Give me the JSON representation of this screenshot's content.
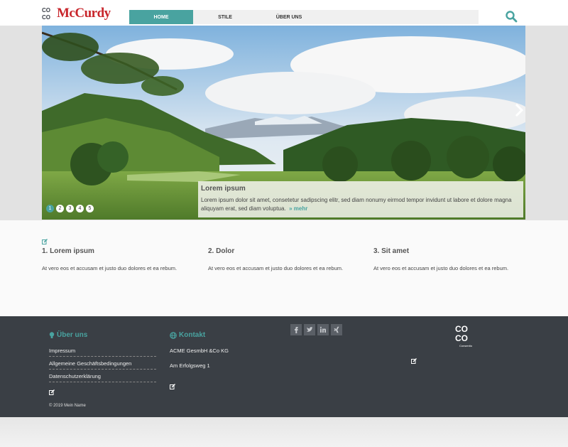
{
  "header": {
    "logo": {
      "letters": [
        "CO",
        "CO"
      ],
      "brand": "McCurdy"
    },
    "nav": [
      {
        "label": "HOME",
        "active": true
      },
      {
        "label": "STILE",
        "active": false
      },
      {
        "label": "ÜBER UNS",
        "active": false
      }
    ]
  },
  "slider": {
    "dots": [
      "1",
      "2",
      "3",
      "4",
      "5"
    ],
    "active_index": 0,
    "caption": {
      "title": "Lorem ipsum",
      "text": "Lorem ipsum dolor sit amet, consetetur sadipscing elitr, sed diam nonumy eirmod tempor invidunt ut labore et dolore magna aliquyam erat, sed diam voluptua.",
      "more": "mehr"
    }
  },
  "teasers": [
    {
      "title": "1. Lorem ipsum",
      "text": "At vero eos et accusam et justo duo dolores et ea rebum."
    },
    {
      "title": "2. Dolor",
      "text": "At vero eos et accusam et justo duo dolores et ea rebum."
    },
    {
      "title": "3. Sit amet",
      "text": "At vero eos et accusam et justo duo dolores et ea rebum."
    }
  ],
  "footer": {
    "about": {
      "title": "Über uns",
      "links": [
        "Impressum",
        "Allgemeine Geschäftsbedingungen",
        "Datenschutzerklärung"
      ]
    },
    "contact": {
      "title": "Kontakt",
      "company": "ACME GesmbH &Co KG",
      "address": "Am Erfolgsweg 1"
    },
    "socials": [
      "facebook-icon",
      "twitter-icon",
      "linkedin-icon",
      "xing-icon"
    ],
    "coco_logo": {
      "letters": [
        "CO",
        "CO"
      ],
      "sub": "Consentio"
    },
    "copyright": "© 2019 Mein Name"
  },
  "colors": {
    "accent": "#49a3a0",
    "brand_red": "#c8262c",
    "footer_bg": "#3a3f45"
  }
}
